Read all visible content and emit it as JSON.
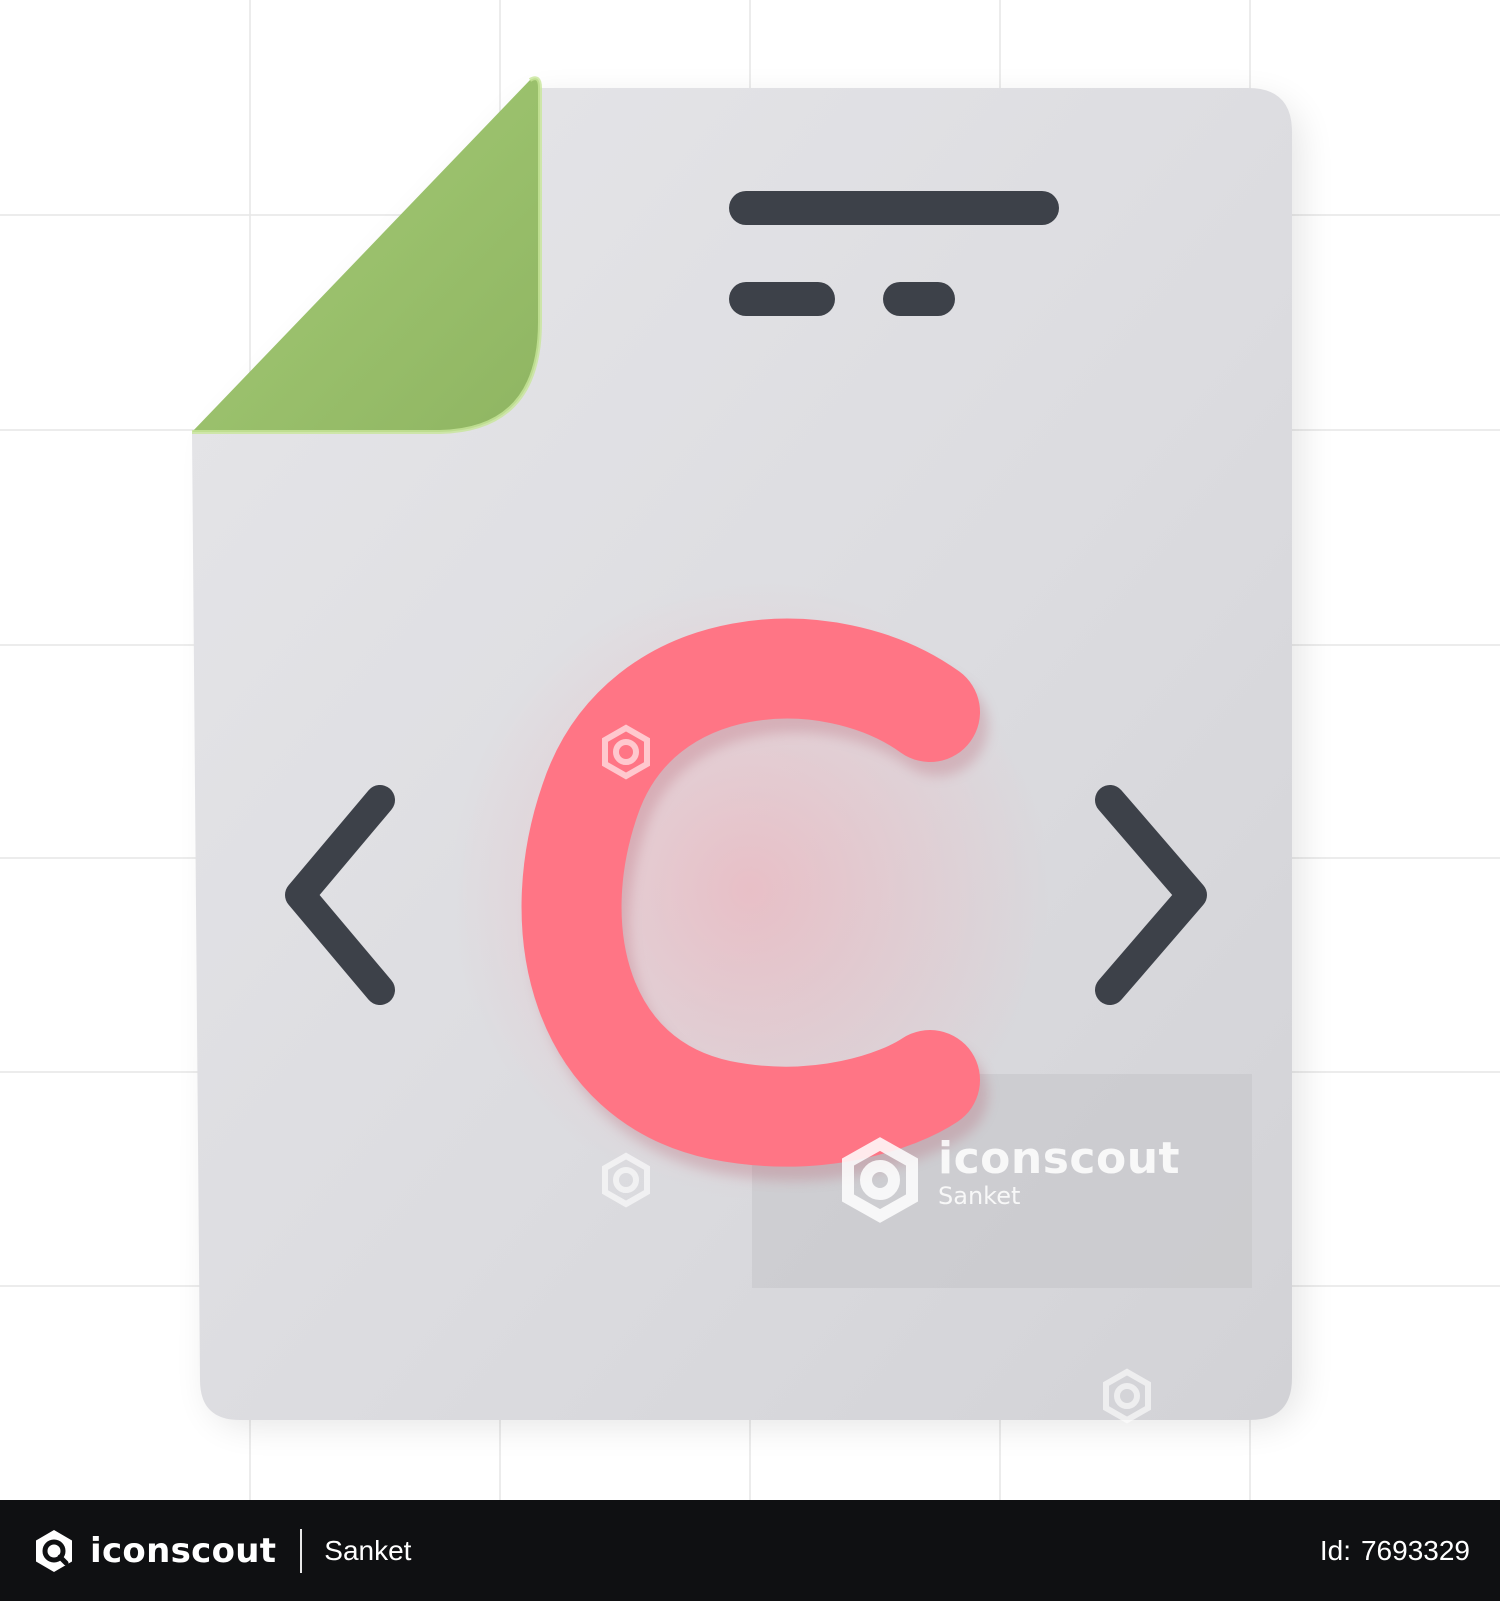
{
  "image": {
    "subject": "C source code file",
    "glyph": "C",
    "colors": {
      "document": "#dddde0",
      "corner_fold": "#97bd6a",
      "letter": "#ff7585",
      "brackets": "#3d4149",
      "header_lines": "#3d4149"
    },
    "icons": [
      "document-icon",
      "corner-fold-icon",
      "less-than-bracket-icon",
      "greater-than-bracket-icon",
      "c-letter-icon",
      "text-line-icon"
    ]
  },
  "watermark": {
    "brand": "iconscout",
    "author": "Sanket"
  },
  "footer": {
    "brand": "iconscout",
    "author": "Sanket",
    "id_label": "Id:",
    "id_value": "7693329",
    "background": "#0f1012"
  }
}
